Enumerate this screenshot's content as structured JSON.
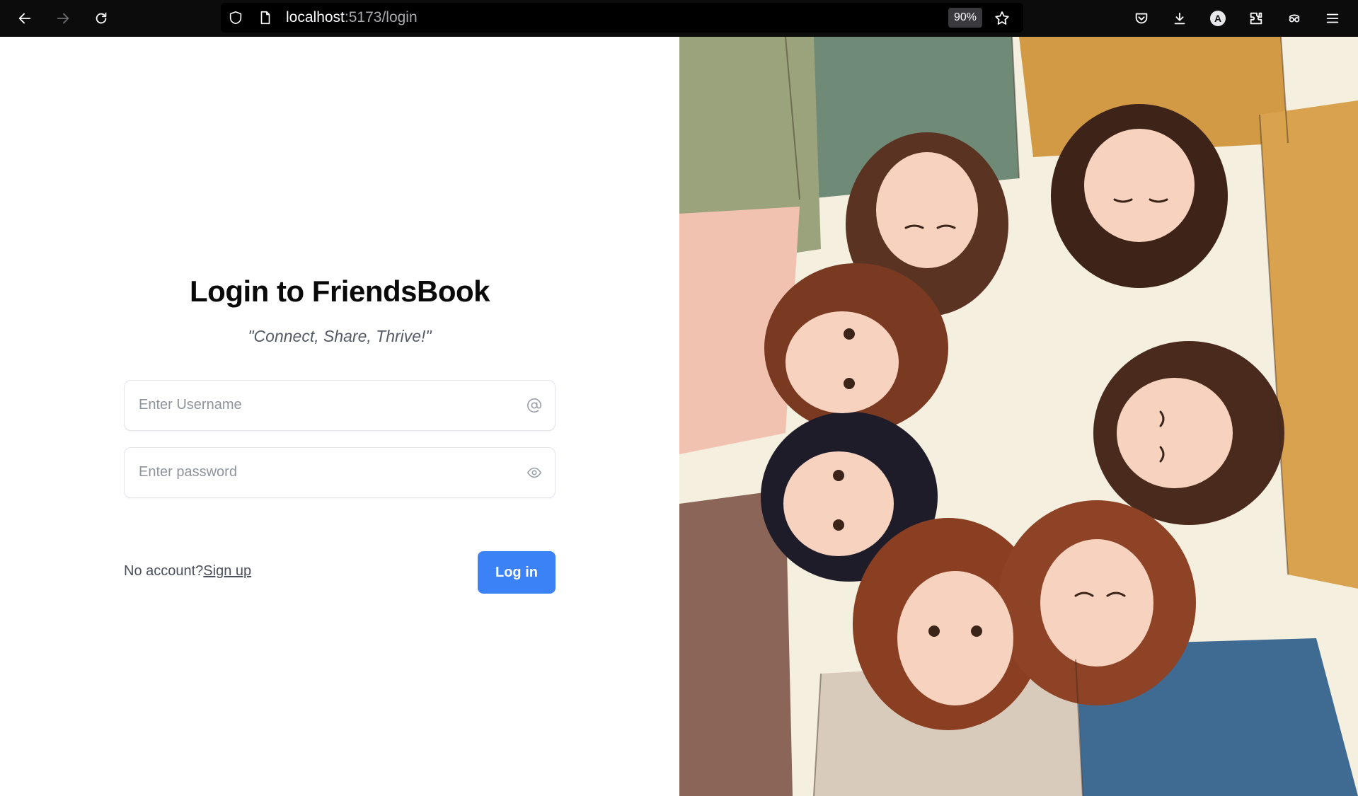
{
  "browser": {
    "url_host": "localhost",
    "url_path": ":5173/login",
    "zoom": "90%",
    "account_initial": "A",
    "icons": [
      "back-icon",
      "forward-icon",
      "reload-icon",
      "shield-icon",
      "page-icon",
      "star-icon",
      "pocket-icon",
      "download-icon",
      "account-icon",
      "extensions-icon",
      "mask-icon",
      "menu-icon"
    ]
  },
  "login": {
    "title": "Login to FriendsBook",
    "tagline": "\"Connect, Share, Thrive!\"",
    "username_placeholder": "Enter Username",
    "password_placeholder": "Enter password",
    "no_account_text": "No account?",
    "signup_link": "Sign up",
    "login_button": "Log in"
  },
  "hero_image": {
    "description_icon": "illustration-image"
  },
  "colors": {
    "accent": "#3b82f6",
    "toolbar": "#0c0c0d",
    "illustration_bg": "#f5efdf"
  }
}
